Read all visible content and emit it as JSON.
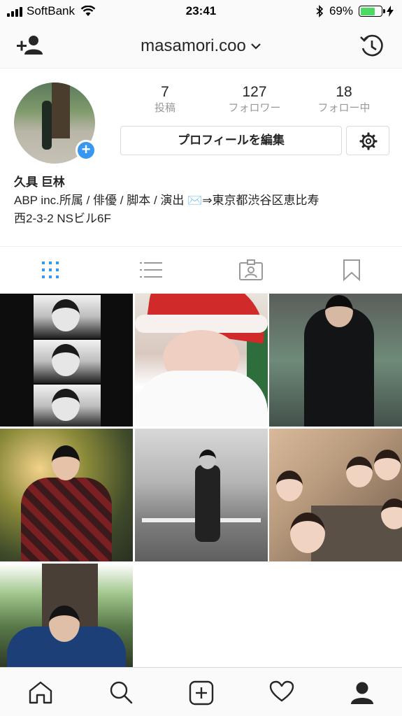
{
  "status_bar": {
    "carrier": "SoftBank",
    "time": "23:41",
    "battery_percent": "69%",
    "battery_level": 0.69
  },
  "header": {
    "username": "masamori.coo",
    "icons": {
      "left": "add-user-icon",
      "dropdown": "chevron-down-icon",
      "right": "history-icon"
    }
  },
  "profile": {
    "stats": [
      {
        "value": "7",
        "label": "投稿"
      },
      {
        "value": "127",
        "label": "フォロワー"
      },
      {
        "value": "18",
        "label": "フォロー中"
      }
    ],
    "edit_button": "プロフィールを編集",
    "display_name": "久具 巨林",
    "bio_line1": "ABP inc.所属 / 俳優 / 脚本 / 演出 ✉️⇒東京都渋谷区恵比寿",
    "bio_line2": "西2-3-2 NSビル6F"
  },
  "tabs": [
    "grid-icon",
    "list-icon",
    "tagged-icon",
    "saved-icon"
  ],
  "colors": {
    "accent": "#3897f0",
    "active_tab": "#3897f0",
    "inactive_tab": "#999999",
    "battery_fill": "#4cd964"
  },
  "bottom_nav": [
    "home-icon",
    "search-icon",
    "new-post-icon",
    "activity-heart-icon",
    "profile-icon"
  ]
}
